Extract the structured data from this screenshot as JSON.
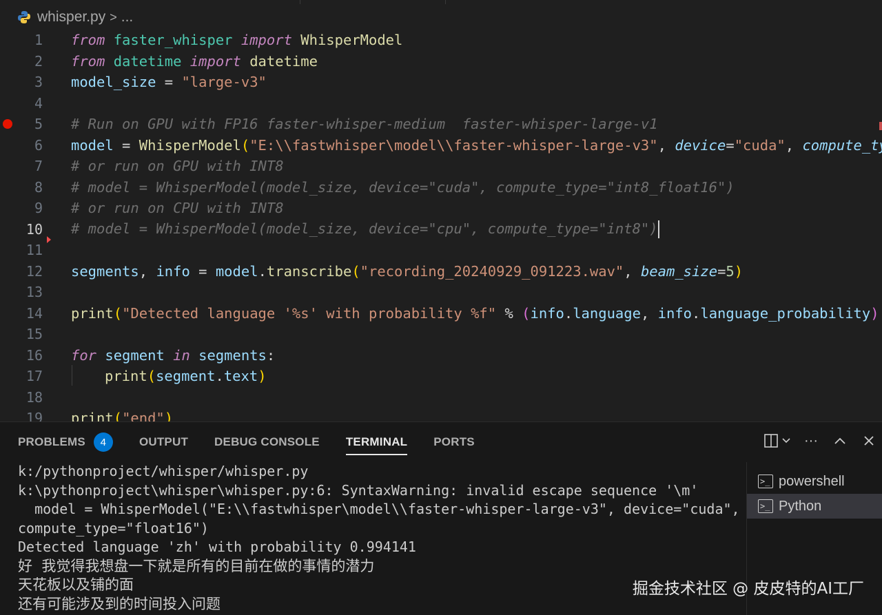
{
  "breadcrumb": {
    "file": "whisper.py",
    "separator": ">",
    "more": "..."
  },
  "editor": {
    "active_line": "10",
    "lines": [
      {
        "n": "1"
      },
      {
        "n": "2"
      },
      {
        "n": "3"
      },
      {
        "n": "4"
      },
      {
        "n": "5"
      },
      {
        "n": "6"
      },
      {
        "n": "7"
      },
      {
        "n": "8"
      },
      {
        "n": "9"
      },
      {
        "n": "10"
      },
      {
        "n": "11"
      },
      {
        "n": "12"
      },
      {
        "n": "13"
      },
      {
        "n": "14"
      },
      {
        "n": "15"
      },
      {
        "n": "16"
      },
      {
        "n": "17"
      },
      {
        "n": "18"
      },
      {
        "n": "19"
      }
    ],
    "code": {
      "l1": {
        "kw1": "from",
        "mod": " faster_whisper ",
        "kw2": "import",
        "cls": " WhisperModel"
      },
      "l2": {
        "kw1": "from",
        "mod": " datetime ",
        "kw2": "import",
        "cls": " datetime"
      },
      "l3": {
        "var": "model_size",
        "op": " = ",
        "str": "\"large-v3\""
      },
      "l5": {
        "cmt": "# Run on GPU with FP16 faster-whisper-medium  faster-whisper-large-v1"
      },
      "l6": {
        "var": "model",
        "op": " = ",
        "cls": "WhisperModel",
        "p": "(",
        "str": "\"E:\\\\fastwhisper\\model\\\\faster-whisper-large-v3\"",
        "c1": ", ",
        "prm1": "device",
        "eq1": "=",
        "str2": "\"cuda\"",
        "c2": ", ",
        "prm2": "compute_type"
      },
      "l7": {
        "cmt": "# or run on GPU with INT8"
      },
      "l8": {
        "cmt": "# model = WhisperModel(model_size, device=\"cuda\", compute_type=\"int8_float16\")"
      },
      "l9": {
        "cmt": "# or run on CPU with INT8"
      },
      "l10": {
        "cmt": "# model = WhisperModel(model_size, device=\"cpu\", compute_type=\"int8\")"
      },
      "l12": {
        "v1": "segments",
        "c": ", ",
        "v2": "info",
        "op": " = ",
        "v3": "model",
        "dot": ".",
        "fn": "transcribe",
        "p": "(",
        "str": "\"recording_20240929_091223.wav\"",
        "c2": ", ",
        "prm": "beam_size",
        "eq": "=",
        "num": "5",
        "p2": ")"
      },
      "l14": {
        "fn": "print",
        "p": "(",
        "str": "\"Detected language '%s' with probability %f\"",
        "op": " % ",
        "p2": "(",
        "v1": "info",
        "d1": ".",
        "a1": "language",
        "c": ", ",
        "v2": "info",
        "d2": ".",
        "a2": "language_probability",
        "p3": ")"
      },
      "l16": {
        "kw1": "for",
        "v1": " segment ",
        "kw2": "in",
        "v2": " segments",
        "colon": ":"
      },
      "l17": {
        "fn": "print",
        "p": "(",
        "v1": "segment",
        "d": ".",
        "a": "text",
        "p2": ")"
      },
      "l19": {
        "fn": "print",
        "p": "(",
        "str": "\"end\"",
        "p2": ")"
      }
    }
  },
  "panel": {
    "tabs": [
      {
        "label": "PROBLEMS",
        "badge": "4"
      },
      {
        "label": "OUTPUT"
      },
      {
        "label": "DEBUG CONSOLE"
      },
      {
        "label": "TERMINAL"
      },
      {
        "label": "PORTS"
      }
    ],
    "actions": {
      "split": "◫",
      "chevron": "⌄",
      "more": "···",
      "maximize": "∧",
      "close": "✕"
    },
    "terminal_lines": [
      "k:/pythonproject/whisper/whisper.py",
      "k:\\pythonproject\\whisper\\whisper.py:6: SyntaxWarning: invalid escape sequence '\\m'",
      "  model = WhisperModel(\"E:\\\\fastwhisper\\model\\\\faster-whisper-large-v3\", device=\"cuda\",",
      "compute_type=\"float16\")",
      "Detected language 'zh' with probability 0.994141",
      "好  我觉得我想盘一下就是所有的目前在做的事情的潜力",
      "天花板以及铺的面",
      "还有可能涉及到的时间投入问题"
    ],
    "terminals": [
      {
        "label": "powershell"
      },
      {
        "label": "Python"
      }
    ]
  },
  "watermark": "掘金技术社区 @ 皮皮特的AI工厂"
}
